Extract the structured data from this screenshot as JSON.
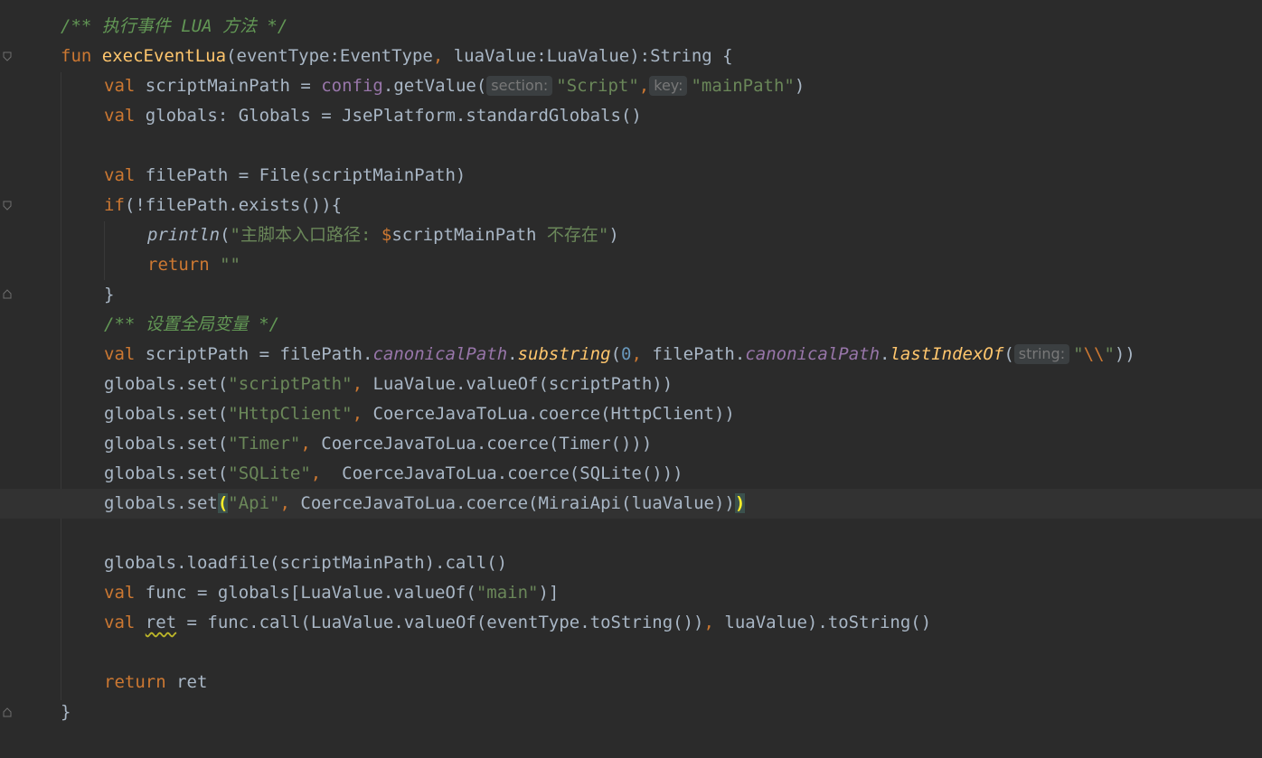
{
  "code": {
    "comment_exec": "/** 执行事件 LUA 方法 */",
    "fun_kw": "fun",
    "fun_name": "execEventLua",
    "sig_a": "(eventType:EventType",
    "sig_comma": ",",
    "sig_b": " luaValue:LuaValue):String {",
    "val_kw": "val",
    "l3_a": " scriptMainPath = ",
    "l3_config": "config",
    "l3_b": ".getValue(",
    "hint_section": "section:",
    "l3_str1": "\"Script\"",
    "hint_key": "key:",
    "l3_str2": "\"mainPath\"",
    "l3_c": ")",
    "l4_a": " globals: Globals = JsePlatform.standardGlobals()",
    "l6_a": " filePath = File(scriptMainPath)",
    "if_kw": "if",
    "l7_a": "(!filePath.exists()){",
    "println": "println",
    "l8_open": "(",
    "l8_str1": "\"主脚本入口路径: ",
    "l8_dollar": "$",
    "l8_var": "scriptMainPath",
    "l8_str2": " 不存在\"",
    "l8_close": ")",
    "return_kw": "return",
    "l9_str": "\"\"",
    "close_brace": "}",
    "comment_globals": "/** 设置全局变量 */",
    "l12_a": " scriptPath = filePath.",
    "canonicalPath": "canonicalPath",
    "dot": ".",
    "substring": "substring",
    "paren_open": "(",
    "zero": "0",
    "l12_b": " filePath.",
    "lastIndexOf": "lastIndexOf",
    "hint_string": "string:",
    "l12_q1": "\"",
    "l12_esc": "\\\\",
    "l12_q2": "\"",
    "l12_end": "))",
    "gset": "globals.set(",
    "l13_str": "\"scriptPath\"",
    "l13_b": " LuaValue.valueOf(scriptPath))",
    "l14_str": "\"HttpClient\"",
    "l14_b": " CoerceJavaToLua.coerce(HttpClient))",
    "l15_str": "\"Timer\"",
    "l15_b": " CoerceJavaToLua.coerce(Timer()))",
    "l16_str": "\"SQLite\"",
    "l16_b": "  CoerceJavaToLua.coerce(SQLite()))",
    "gset_plain": "globals.set",
    "l17_str": "\"Api\"",
    "l17_b": " CoerceJavaToLua.coerce(MiraiApi(luaValue))",
    "l17_close": ")",
    "l19": "globals.loadfile(scriptMainPath).call()",
    "l20_a": " func = globals[LuaValue.valueOf(",
    "l20_str": "\"main\"",
    "l20_b": ")]",
    "ret_var": "ret",
    "l21_a": " = func.call(LuaValue.valueOf(eventType.toString())",
    "l21_b": " luaValue).toString()",
    "l23_b": " ret"
  }
}
